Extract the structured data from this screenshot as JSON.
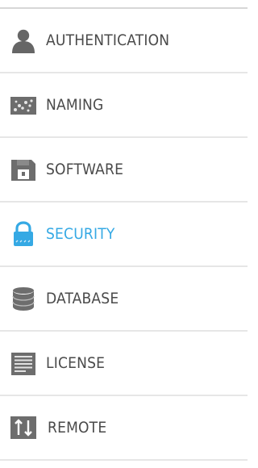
{
  "sidebar": {
    "active_color": "#35a9e4",
    "text_color": "#4a4a4a",
    "icon_color": "#6d6d6d",
    "items": [
      {
        "label": "AUTHENTICATION",
        "icon": "user-icon"
      },
      {
        "label": "NAMING",
        "icon": "naming-icon"
      },
      {
        "label": "SOFTWARE",
        "icon": "software-disk-icon"
      },
      {
        "label": "SECURITY",
        "icon": "lock-icon",
        "active": true
      },
      {
        "label": "DATABASE",
        "icon": "database-icon"
      },
      {
        "label": "LICENSE",
        "icon": "license-document-icon"
      },
      {
        "label": "REMOTE",
        "icon": "remote-transfer-icon"
      }
    ]
  }
}
